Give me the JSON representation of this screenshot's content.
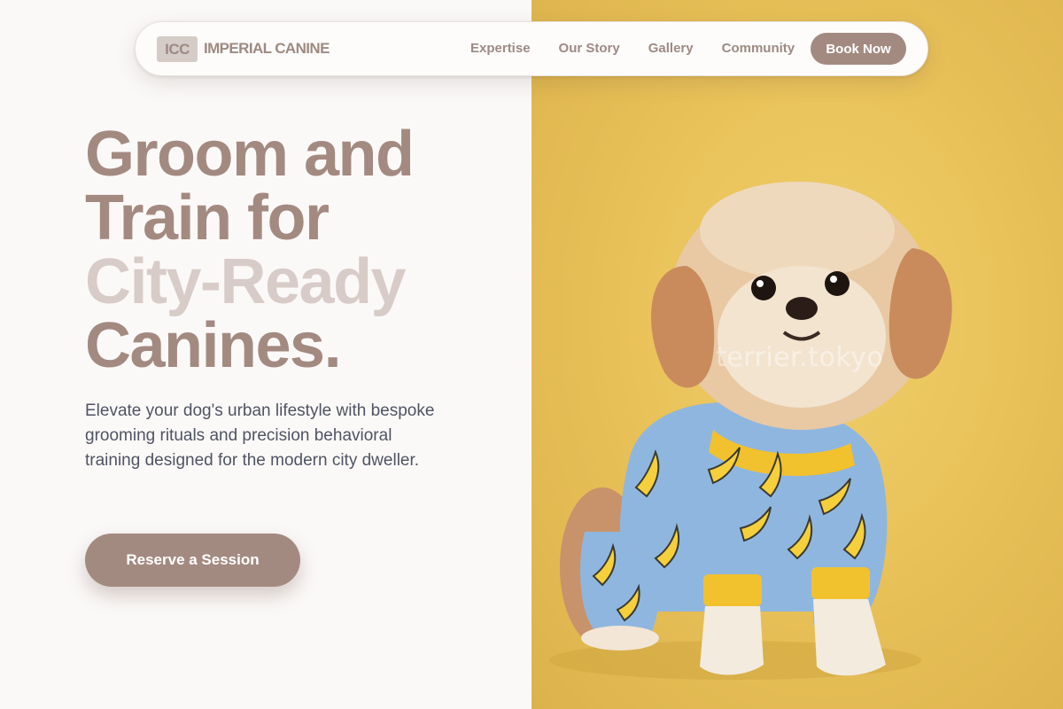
{
  "nav": {
    "logo_abbrev": "ICC",
    "brand_name": "IMPERIAL CANINE",
    "links": [
      "Expertise",
      "Our Story",
      "Gallery",
      "Community"
    ],
    "cta": "Book Now"
  },
  "hero": {
    "title_line1": "Groom and",
    "title_line2": "Train for",
    "title_line3": "City-Ready",
    "title_line4": "Canines.",
    "description": "Elevate your dog's urban lifestyle with bespoke grooming rituals and precision behavioral training designed for the modern city dweller.",
    "cta": "Reserve a Session"
  },
  "image": {
    "watermark": "terrier.tokyo"
  },
  "colors": {
    "accent": "#a38a81",
    "accent_light": "#d8ccc8",
    "background": "#fbf9f8",
    "image_background": "#e9c25a",
    "body_text": "#4f5463"
  }
}
